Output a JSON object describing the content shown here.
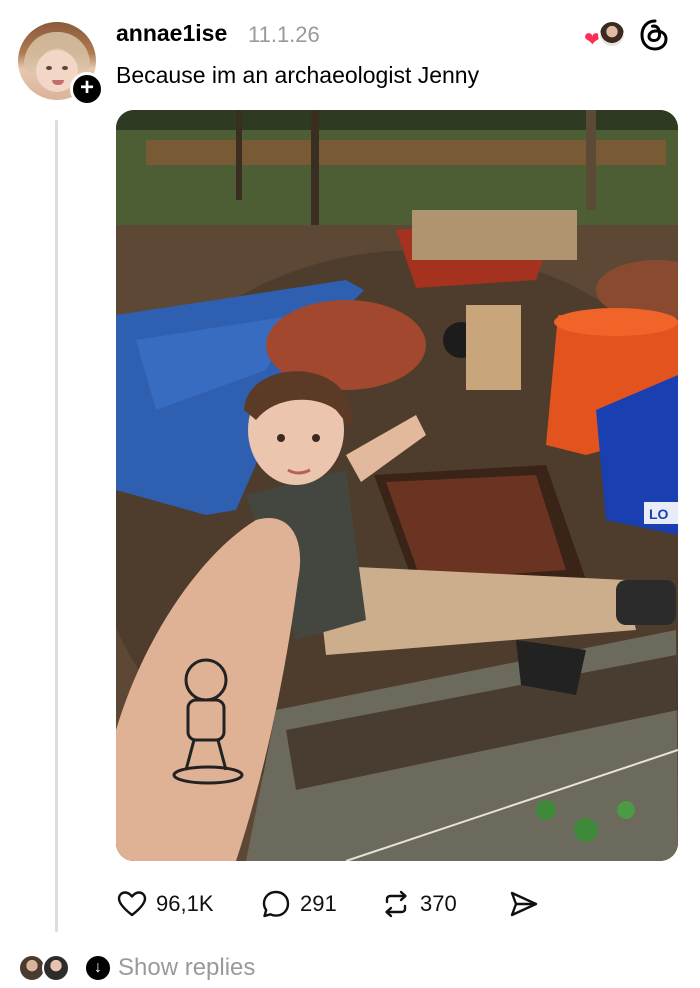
{
  "post": {
    "username": "annae1ise",
    "timestamp": "11.1.26",
    "text": "Because im an archaeologist Jenny",
    "follow_icon": "plus-icon",
    "app_icon": "threads-logo-icon"
  },
  "photo": {
    "bucket_text": "LO"
  },
  "actions": {
    "likes": "96,1K",
    "comments": "291",
    "reposts": "370"
  },
  "replies": {
    "label": "Show replies"
  },
  "colors": {
    "heart": "#ff2e55",
    "muted": "#9a9a9a",
    "text": "#101010"
  }
}
